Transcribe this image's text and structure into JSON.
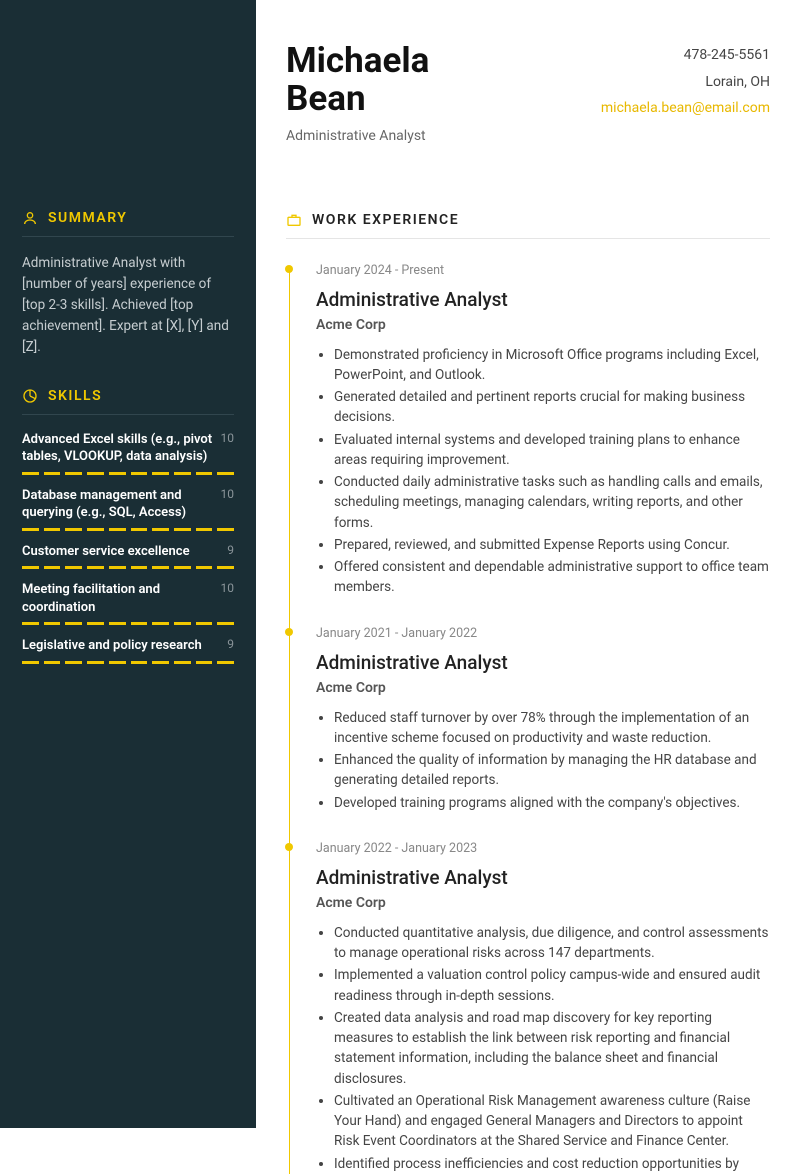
{
  "name": "Michaela Bean",
  "subtitle": "Administrative Analyst",
  "contact": {
    "phone": "478-245-5561",
    "location": "Lorain, OH",
    "email": "michaela.bean@email.com"
  },
  "sections": {
    "summary": "SUMMARY",
    "skills": "SKILLS",
    "work": "WORK EXPERIENCE"
  },
  "summary_text": "Administrative Analyst with [number of years] experience of [top 2-3 skills]. Achieved [top achievement]. Expert at [X], [Y] and [Z].",
  "skills": [
    {
      "name": "Advanced Excel skills (e.g., pivot tables, VLOOKUP, data analysis)",
      "score": "10"
    },
    {
      "name": "Database management and querying (e.g., SQL, Access)",
      "score": "10"
    },
    {
      "name": "Customer service excellence",
      "score": "9"
    },
    {
      "name": "Meeting facilitation and coordination",
      "score": "10"
    },
    {
      "name": "Legislative and policy research",
      "score": "9"
    }
  ],
  "jobs": [
    {
      "date": "January 2024 - Present",
      "title": "Administrative Analyst",
      "company": "Acme Corp",
      "bullets": [
        "Demonstrated proficiency in Microsoft Office programs including Excel, PowerPoint, and Outlook.",
        "Generated detailed and pertinent reports crucial for making business decisions.",
        "Evaluated internal systems and developed training plans to enhance areas requiring improvement.",
        "Conducted daily administrative tasks such as handling calls and emails, scheduling meetings, managing calendars, writing reports, and other forms.",
        "Prepared, reviewed, and submitted Expense Reports using Concur.",
        "Offered consistent and dependable administrative support to office team members."
      ]
    },
    {
      "date": "January 2021 - January 2022",
      "title": "Administrative Analyst",
      "company": "Acme Corp",
      "bullets": [
        "Reduced staff turnover by over 78% through the implementation of an incentive scheme focused on productivity and waste reduction.",
        "Enhanced the quality of information by managing the HR database and generating detailed reports.",
        "Developed training programs aligned with the company's objectives."
      ]
    },
    {
      "date": "January 2022 - January 2023",
      "title": "Administrative Analyst",
      "company": "Acme Corp",
      "bullets": [
        "Conducted quantitative analysis, due diligence, and control assessments to manage operational risks across 147 departments.",
        "Implemented a valuation control policy campus-wide and ensured audit readiness through in-depth sessions.",
        "Created data analysis and road map discovery for key reporting measures to establish the link between risk reporting and financial statement information, including the balance sheet and financial disclosures.",
        "Cultivated an Operational Risk Management awareness culture (Raise Your Hand) and engaged General Managers and Directors to appoint Risk Event Coordinators at the Shared Service and Finance Center.",
        "Identified process inefficiencies and cost reduction opportunities by"
      ]
    }
  ]
}
